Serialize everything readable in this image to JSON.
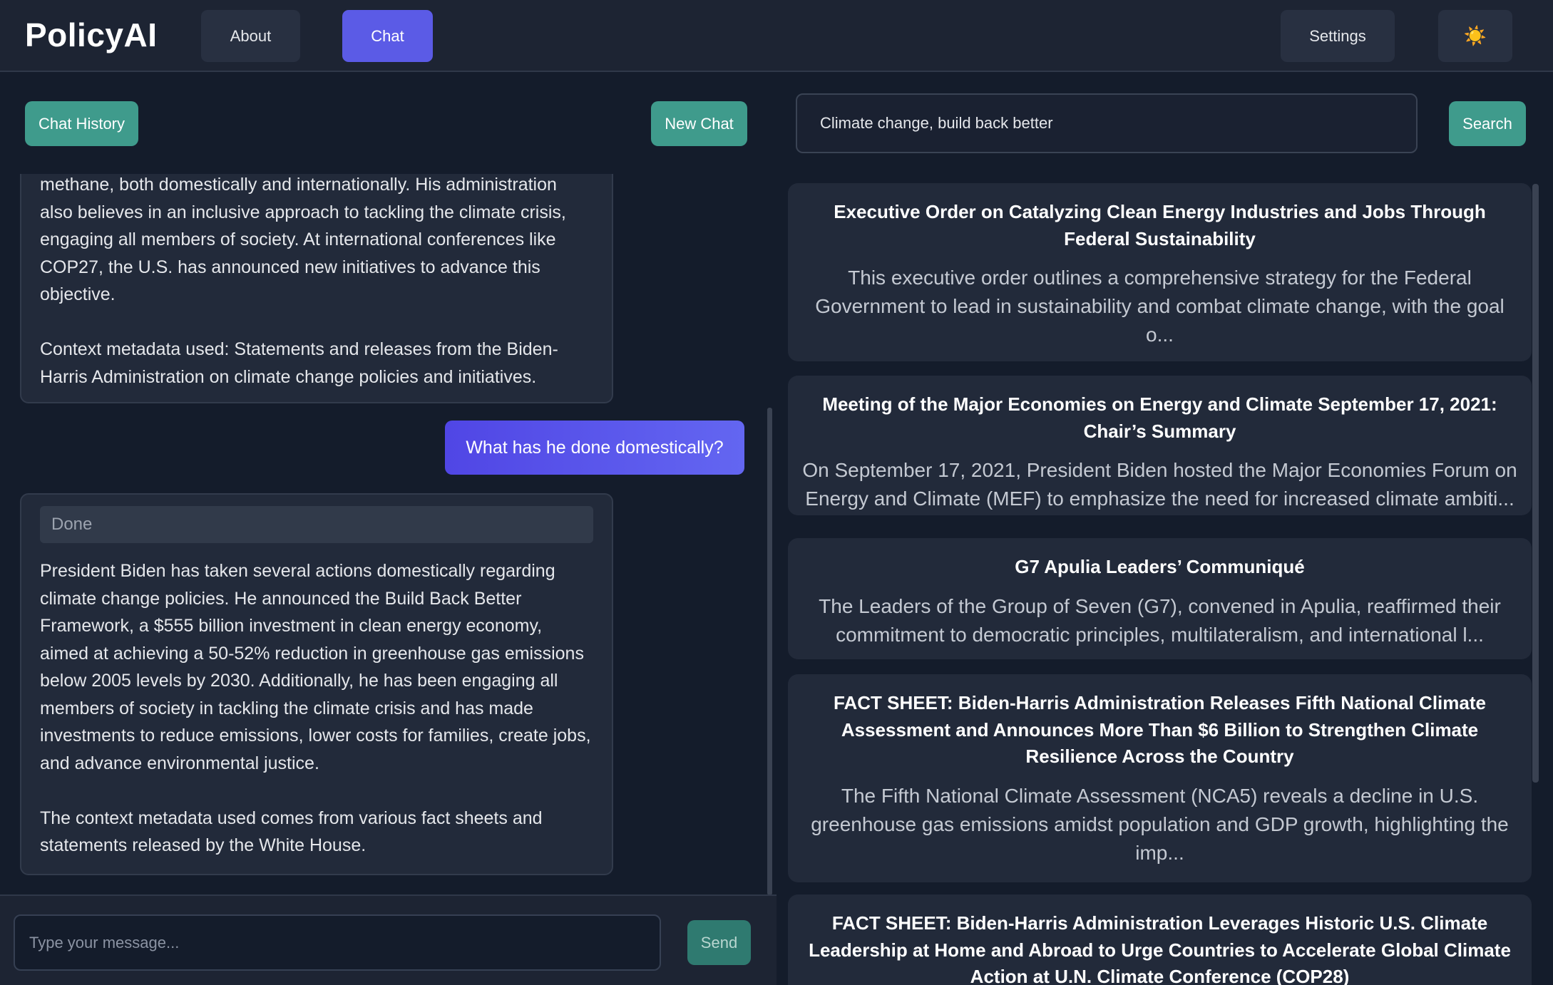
{
  "nav": {
    "brand": "PolicyAI",
    "about": "About",
    "chat": "Chat",
    "settings": "Settings",
    "theme_icon": "☀️"
  },
  "chat_panel": {
    "history_label": "Chat History",
    "new_chat_label": "New Chat",
    "messages": [
      {
        "role": "assistant",
        "paragraphs": [
          "methane, both domestically and internationally. His administration also believes in an inclusive approach to tackling the climate crisis, engaging all members of society. At international conferences like COP27, the U.S. has announced new initiatives to advance this objective.",
          "Context metadata used: Statements and releases from the Biden-Harris Administration on climate change policies and initiatives."
        ]
      },
      {
        "role": "user",
        "text": "What has he done domestically?"
      },
      {
        "role": "assistant",
        "status": "Done",
        "paragraphs": [
          "President Biden has taken several actions domestically regarding climate change policies. He announced the Build Back Better Framework, a $555 billion investment in clean energy economy, aimed at achieving a 50-52% reduction in greenhouse gas emissions below 2005 levels by 2030. Additionally, he has been engaging all members of society in tackling the climate crisis and has made investments to reduce emissions, lower costs for families, create jobs, and advance environmental justice.",
          "The context metadata used comes from various fact sheets and statements released by the White House."
        ]
      }
    ],
    "input_placeholder": "Type your message...",
    "send_label": "Send"
  },
  "search_panel": {
    "query": "Climate change, build back better",
    "search_label": "Search",
    "results": [
      {
        "title": "Executive Order on Catalyzing Clean Energy Industries and Jobs Through Federal Sustainability",
        "snippet": "This executive order outlines a comprehensive strategy for the Federal Government to lead in sustainability and combat climate change, with the goal o..."
      },
      {
        "title": "Meeting of the Major Economies on Energy and Climate September 17, 2021: Chair’s Summary",
        "snippet": "On September 17, 2021, President Biden hosted the Major Economies Forum on Energy and Climate (MEF) to emphasize the need for increased climate ambiti..."
      },
      {
        "title": "G7 Apulia Leaders’ Communiqué",
        "snippet": "The Leaders of the Group of Seven (G7), convened in Apulia, reaffirmed their commitment to democratic principles, multilateralism, and international l..."
      },
      {
        "title": "FACT SHEET: Biden-Harris Administration Releases Fifth National Climate Assessment and Announces More Than $6 Billion to Strengthen Climate Resilience Across the Country",
        "snippet": "The Fifth National Climate Assessment (NCA5) reveals a decline in U.S. greenhouse gas emissions amidst population and GDP growth, highlighting the imp..."
      },
      {
        "title": "FACT SHEET: Biden-Harris Administration Leverages Historic U.S. Climate Leadership at Home and Abroad to Urge Countries to Accelerate Global Climate Action at U.N. Climate Conference (COP28)",
        "snippet": ""
      }
    ]
  }
}
